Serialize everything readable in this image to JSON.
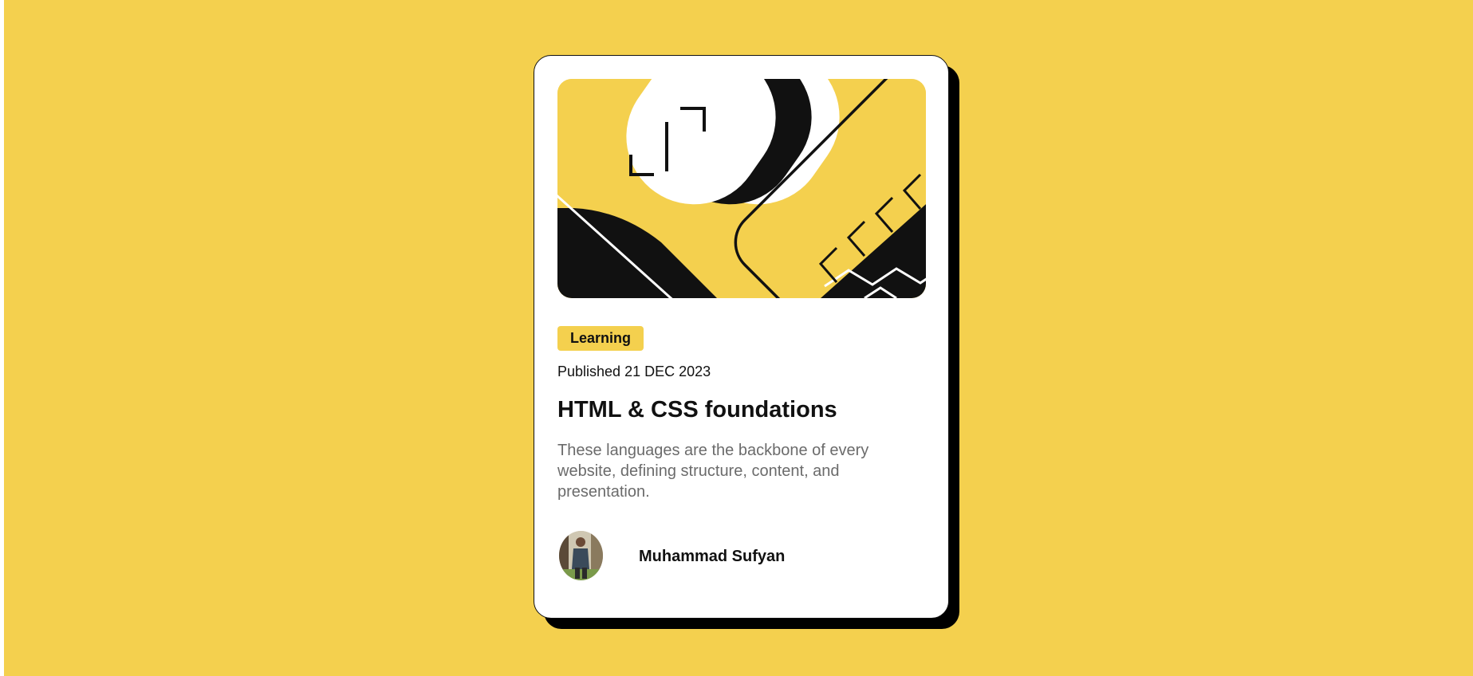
{
  "card": {
    "hero_image": "hero-illustration",
    "tag": "Learning",
    "published_label": "Published",
    "published_date": "21 DEC 2023",
    "title": "HTML & CSS foundations",
    "description": "These languages are the backbone of every website, defining structure, content, and presentation.",
    "author": {
      "name": "Muhammad Sufyan",
      "avatar": "author-avatar"
    }
  },
  "colors": {
    "background": "#f4d04e",
    "card": "#ffffff",
    "text": "#111111",
    "muted_text": "#6b6b6b",
    "shadow": "#000000"
  }
}
